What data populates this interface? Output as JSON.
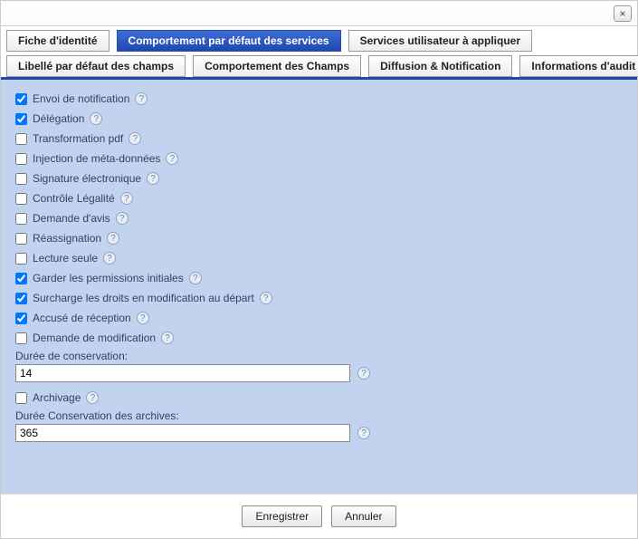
{
  "close_label": "×",
  "tabs_primary": [
    {
      "id": "identity",
      "label": "Fiche d'identité",
      "active": false
    },
    {
      "id": "default-behavior",
      "label": "Comportement par défaut des services",
      "active": true
    },
    {
      "id": "user-services",
      "label": "Services utilisateur à appliquer",
      "active": false
    }
  ],
  "tabs_secondary": [
    {
      "id": "default-labels",
      "label": "Libellé par défaut des champs"
    },
    {
      "id": "field-behavior",
      "label": "Comportement des Champs"
    },
    {
      "id": "diffusion",
      "label": "Diffusion & Notification"
    },
    {
      "id": "audit",
      "label": "Informations d'audit"
    }
  ],
  "options": [
    {
      "id": "envoi-notification",
      "label": "Envoi de notification",
      "checked": true
    },
    {
      "id": "delegation",
      "label": "Délégation",
      "checked": true
    },
    {
      "id": "transformation-pdf",
      "label": "Transformation pdf",
      "checked": false
    },
    {
      "id": "injection-meta",
      "label": "Injection de méta-données",
      "checked": false
    },
    {
      "id": "signature-elec",
      "label": "Signature électronique",
      "checked": false
    },
    {
      "id": "controle-legalite",
      "label": "Contrôle Légalité",
      "checked": false
    },
    {
      "id": "demande-avis",
      "label": "Demande d'avis",
      "checked": false
    },
    {
      "id": "reassignation",
      "label": "Réassignation",
      "checked": false
    },
    {
      "id": "lecture-seule",
      "label": "Lecture seule",
      "checked": false
    },
    {
      "id": "garder-permissions",
      "label": "Garder les permissions initiales",
      "checked": true
    },
    {
      "id": "surcharge-droits",
      "label": "Surcharge les droits en modification au départ",
      "checked": true
    },
    {
      "id": "accuse-reception",
      "label": "Accusé de réception",
      "checked": true
    },
    {
      "id": "demande-modif",
      "label": "Demande de modification",
      "checked": false
    }
  ],
  "fields": {
    "duree_conservation": {
      "label": "Durée de conservation:",
      "value": "14"
    },
    "archivage": {
      "label": "Archivage",
      "checked": false
    },
    "duree_archives": {
      "label": "Durée Conservation des archives:",
      "value": "365"
    }
  },
  "buttons": {
    "save": "Enregistrer",
    "cancel": "Annuler"
  },
  "help_glyph": "?"
}
